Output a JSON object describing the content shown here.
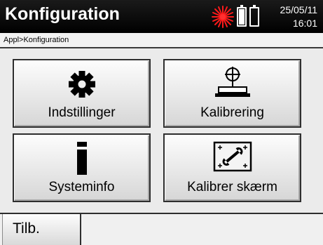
{
  "header": {
    "title": "Konfiguration",
    "date": "25/05/11",
    "time": "16:01",
    "laser_color": "#ff0000"
  },
  "breadcrumb": "Appl>Konfiguration",
  "tiles": [
    {
      "label": "Indstillinger",
      "icon": "gear-icon"
    },
    {
      "label": "Kalibrering",
      "icon": "level-calibration-icon"
    },
    {
      "label": "Systeminfo",
      "icon": "info-icon"
    },
    {
      "label": "Kalibrer skærm",
      "icon": "screen-calibration-icon"
    }
  ],
  "footer": {
    "back_label": "Tilb."
  }
}
